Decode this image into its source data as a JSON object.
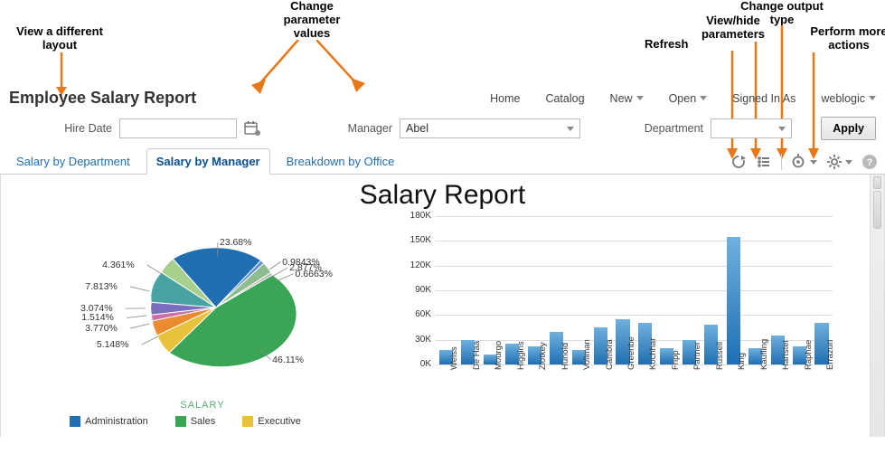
{
  "annotations": {
    "layout": "View a different\nlayout",
    "params": "Change\nparameter\nvalues",
    "refresh": "Refresh",
    "viewhide": "View/hide\nparameters",
    "output": "Change output\ntype",
    "actions": "Perform more\nactions"
  },
  "header": {
    "title": "Employee Salary Report",
    "nav": {
      "home": "Home",
      "catalog": "Catalog",
      "new": "New",
      "open": "Open",
      "signed": "Signed In As",
      "user": "weblogic"
    }
  },
  "params": {
    "hire_date_label": "Hire Date",
    "hire_date_value": "",
    "manager_label": "Manager",
    "manager_value": "Abel",
    "department_label": "Department",
    "department_value": "",
    "apply": "Apply"
  },
  "tabs": {
    "salary_dept": "Salary by Department",
    "salary_mgr": "Salary by Manager",
    "breakdown": "Breakdown by Office"
  },
  "report": {
    "title": "Salary Report",
    "pie_axis": "SALARY",
    "legend": {
      "admin": "Administration",
      "sales": "Sales",
      "exec": "Executive"
    }
  },
  "colors": {
    "admin": "#1f6fb2",
    "sales": "#3aa655",
    "exec": "#e8c23a",
    "slice_orange": "#e98b2e",
    "slice_teal": "#4aa3a3",
    "slice_purple": "#7a6fbf",
    "slice_pink": "#cf6fa3",
    "slice_lightg": "#a8d08d",
    "slice_blue2": "#5a8fd6"
  },
  "chart_data": [
    {
      "type": "pie",
      "title": "SALARY",
      "slices": [
        {
          "label": "46.11%",
          "value": 46.11,
          "color": "#3aa655"
        },
        {
          "label": "5.148%",
          "value": 5.148,
          "color": "#e8c23a"
        },
        {
          "label": "3.770%",
          "value": 3.77,
          "color": "#e98b2e"
        },
        {
          "label": "1.514%",
          "value": 1.514,
          "color": "#cf6fa3"
        },
        {
          "label": "3.074%",
          "value": 3.074,
          "color": "#7a6fbf"
        },
        {
          "label": "7.813%",
          "value": 7.813,
          "color": "#4aa3a3"
        },
        {
          "label": "4.361%",
          "value": 4.361,
          "color": "#a8d08d"
        },
        {
          "label": "23.68%",
          "value": 23.68,
          "color": "#1f6fb2"
        },
        {
          "label": "0.9843%",
          "value": 0.9843,
          "color": "#5a8fd6"
        },
        {
          "label": "2.877%",
          "value": 2.877,
          "color": "#8fbc8f"
        },
        {
          "label": "0.6663%",
          "value": 0.6663,
          "color": "#b0b0b0"
        }
      ],
      "legend": [
        "Administration",
        "Sales",
        "Executive"
      ]
    },
    {
      "type": "bar",
      "ylabel": "",
      "ylim": [
        0,
        180
      ],
      "yticks": [
        "0K",
        "30K",
        "60K",
        "90K",
        "120K",
        "150K",
        "180K"
      ],
      "categories": [
        "Weiss",
        "De Haa",
        "Mourgo",
        "Higgins",
        "Zlotkey",
        "Hunold",
        "Vollman",
        "Cambra",
        "Greenbe",
        "Kochhar",
        "Fripp",
        "Partner",
        "Russell",
        "King",
        "Kaufling",
        "Hartstel",
        "Raphae",
        "Errazuri"
      ],
      "values": [
        18,
        30,
        12,
        25,
        22,
        40,
        18,
        45,
        55,
        50,
        20,
        30,
        48,
        155,
        20,
        35,
        22,
        50
      ]
    }
  ]
}
